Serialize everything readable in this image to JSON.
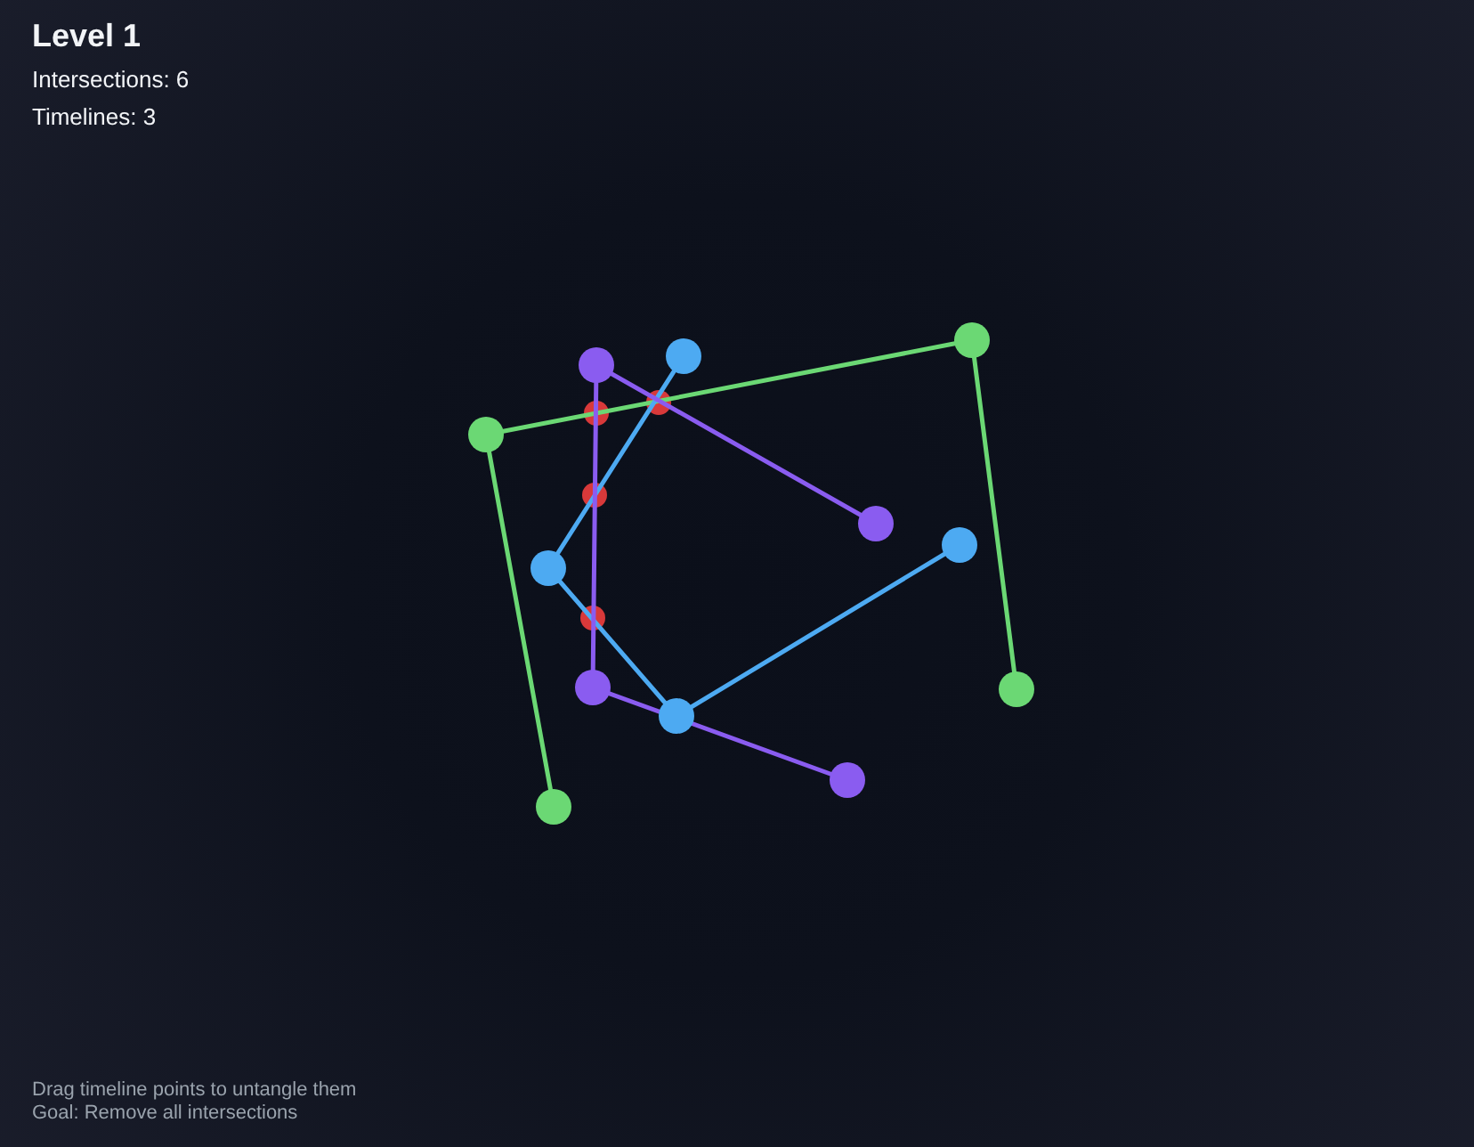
{
  "hud": {
    "title": "Level 1",
    "intersections": "Intersections: 6",
    "timelines": "Timelines: 3"
  },
  "timelines": [
    {
      "color": "#6bd874"
    },
    {
      "color": "#4daaf2"
    },
    {
      "color": "#8a5cf0"
    }
  ],
  "instructions": [
    "Drag timeline points to untangle them",
    "Goal: Remove all intersections"
  ]
}
